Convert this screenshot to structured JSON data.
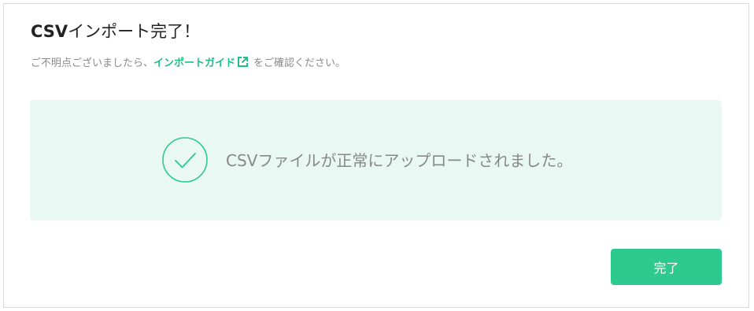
{
  "dialog": {
    "title_prefix": "CSV",
    "title_rest": "インポート完了！",
    "help_before": "ご不明点ございましたら、",
    "help_link": "インポートガイド",
    "help_after": "をご確認ください。",
    "success_message": "CSVファイルが正常にアップロードされました。",
    "done_label": "完了"
  },
  "icons": {
    "link": "external-link-icon",
    "success": "check-circle-icon"
  },
  "colors": {
    "accent": "#2ec98f",
    "link": "#1fbf85",
    "panel_background": "#e9f8f2",
    "title": "#222222",
    "muted_text": "#8a8a8a"
  }
}
